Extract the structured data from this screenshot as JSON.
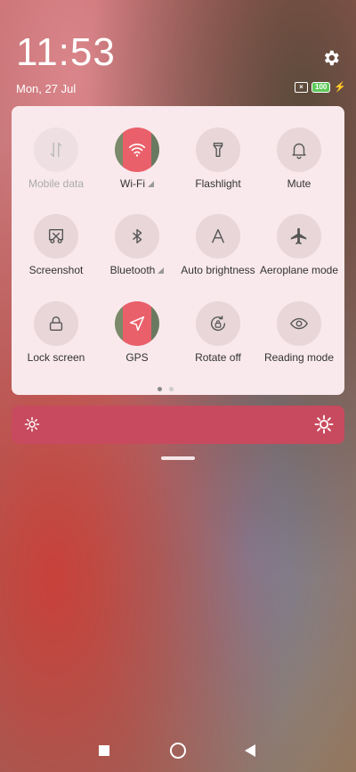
{
  "status": {
    "time": "11:53",
    "date": "Mon, 27 Jul",
    "battery_level": "100"
  },
  "tiles": [
    {
      "label": "Mobile data",
      "icon": "mobile-data-icon",
      "state": "disabled"
    },
    {
      "label": "Wi-Fi",
      "icon": "wifi-icon",
      "state": "active"
    },
    {
      "label": "Flashlight",
      "icon": "flashlight-icon",
      "state": "off"
    },
    {
      "label": "Mute",
      "icon": "bell-icon",
      "state": "off"
    },
    {
      "label": "Screenshot",
      "icon": "screenshot-icon",
      "state": "off"
    },
    {
      "label": "Bluetooth",
      "icon": "bluetooth-icon",
      "state": "off"
    },
    {
      "label": "Auto brightness",
      "icon": "auto-brightness-icon",
      "state": "off"
    },
    {
      "label": "Aeroplane mode",
      "icon": "airplane-icon",
      "state": "off"
    },
    {
      "label": "Lock screen",
      "icon": "lock-icon",
      "state": "off"
    },
    {
      "label": "GPS",
      "icon": "gps-icon",
      "state": "active"
    },
    {
      "label": "Rotate off",
      "icon": "rotate-lock-icon",
      "state": "off"
    },
    {
      "label": "Reading mode",
      "icon": "eye-icon",
      "state": "off"
    }
  ],
  "colors": {
    "panel_bg": "#f9e9ec",
    "tile_bg": "#e8d6d9",
    "active_accent": "#e9606a",
    "brightness_bar": "#c84a5e"
  },
  "pager": {
    "pages": 2,
    "current": 1
  }
}
